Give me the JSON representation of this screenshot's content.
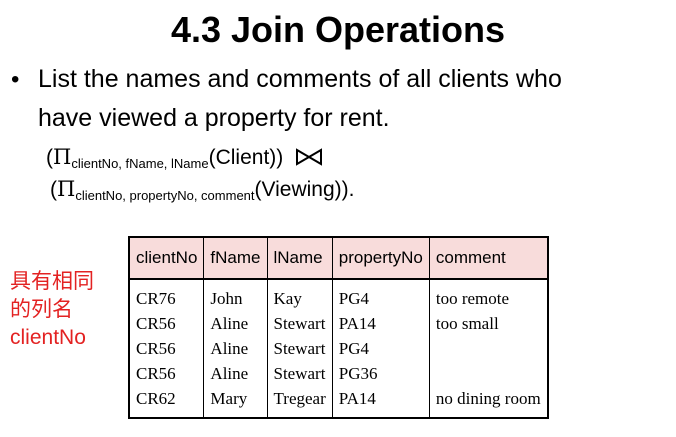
{
  "slide": {
    "title": "4.3 Join Operations",
    "bullet_char": "•",
    "bullet_line1": "List the names and comments of all clients who",
    "bullet_line2": "have viewed a property for rent.",
    "expr1": {
      "open": "(",
      "pi": "Π",
      "sub": "clientNo, fName, lName",
      "rest": "(Client))"
    },
    "expr2": {
      "open": "(",
      "pi": "Π",
      "sub": "clientNo, propertyNo, comment",
      "rest": "(Viewing))."
    },
    "join_symbol": "natural-join-icon",
    "note": [
      "具有相同",
      "的列名",
      "clientNo"
    ],
    "colors": {
      "note": "#e32222",
      "header_bg": "#f8dcdb"
    }
  },
  "table": {
    "headers": [
      "clientNo",
      "fName",
      "lName",
      "propertyNo",
      "comment"
    ],
    "rows": [
      [
        "CR76",
        "John",
        "Kay",
        "PG4",
        "too remote"
      ],
      [
        "CR56",
        "Aline",
        "Stewart",
        "PA14",
        "too small"
      ],
      [
        "CR56",
        "Aline",
        "Stewart",
        "PG4",
        ""
      ],
      [
        "CR56",
        "Aline",
        "Stewart",
        "PG36",
        ""
      ],
      [
        "CR62",
        "Mary",
        "Tregear",
        "PA14",
        "no dining room"
      ]
    ]
  }
}
